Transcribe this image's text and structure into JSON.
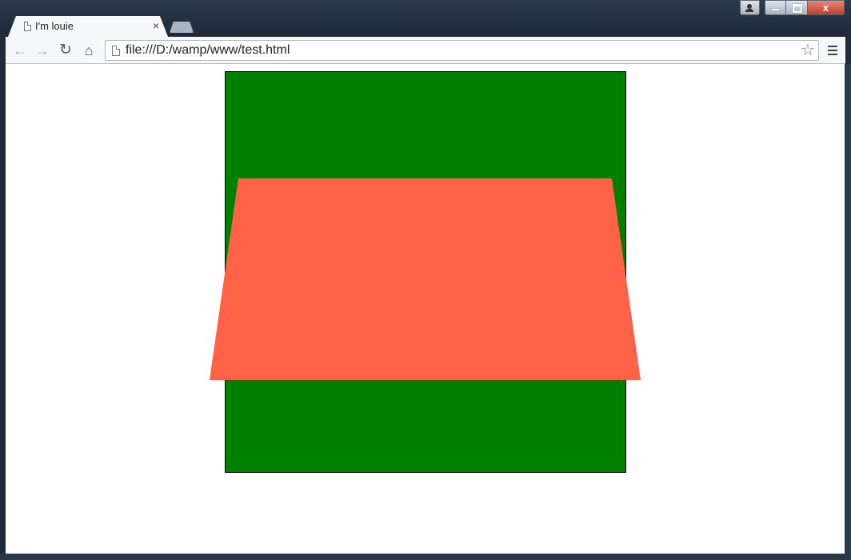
{
  "window": {
    "tab_title": "I'm louie",
    "tab_close": "×",
    "close_glyph": "x"
  },
  "toolbar": {
    "back_icon": "←",
    "forward_icon": "→",
    "reload_icon": "↻",
    "home_icon": "⌂",
    "url": "file:///D:/wamp/www/test.html",
    "star_icon": "☆"
  },
  "page": {
    "box_color": "#008000",
    "shape_color": "#ff6347"
  }
}
